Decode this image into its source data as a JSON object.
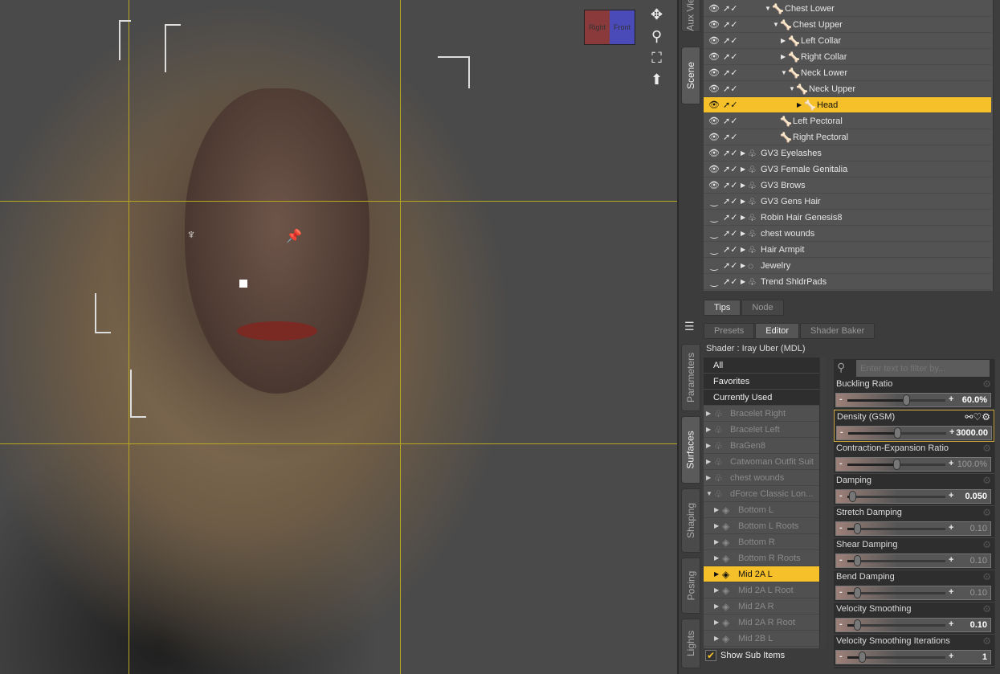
{
  "viewport": {
    "cube_faces": [
      "Right",
      "Front"
    ],
    "tools": [
      "pan-icon",
      "zoom-icon",
      "frame-icon",
      "orbit-icon"
    ]
  },
  "side_tabs_top": [
    "Aux Vie",
    "Scene"
  ],
  "side_tabs_bottom": [
    "Parameters",
    "Surfaces",
    "Shaping",
    "Posing",
    "Lights"
  ],
  "scene": {
    "rows": [
      {
        "label": "Chest Lower",
        "level": 4,
        "type": "bone",
        "expand": "open",
        "visible": true
      },
      {
        "label": "Chest Upper",
        "level": 5,
        "type": "bone",
        "expand": "open",
        "visible": true
      },
      {
        "label": "Left Collar",
        "level": 6,
        "type": "bone",
        "expand": "closed",
        "visible": true
      },
      {
        "label": "Right Collar",
        "level": 6,
        "type": "bone",
        "expand": "closed",
        "visible": true
      },
      {
        "label": "Neck Lower",
        "level": 6,
        "type": "bone",
        "expand": "open",
        "visible": true
      },
      {
        "label": "Neck Upper",
        "level": 7,
        "type": "bone",
        "expand": "open",
        "visible": true
      },
      {
        "label": "Head",
        "level": 8,
        "type": "bone",
        "expand": "closed",
        "visible": true,
        "selected": true
      },
      {
        "label": "Left Pectoral",
        "level": 5,
        "type": "bone",
        "expand": "none",
        "visible": true
      },
      {
        "label": "Right Pectoral",
        "level": 5,
        "type": "bone",
        "expand": "none",
        "visible": true
      },
      {
        "label": "GV3 Eyelashes",
        "level": 1,
        "type": "figure",
        "expand": "closed",
        "visible": true
      },
      {
        "label": "GV3 Female Genitalia",
        "level": 1,
        "type": "figure",
        "expand": "closed",
        "visible": true
      },
      {
        "label": "GV3 Brows",
        "level": 1,
        "type": "figure",
        "expand": "closed",
        "visible": true
      },
      {
        "label": "GV3 Gens Hair",
        "level": 1,
        "type": "figure",
        "expand": "closed",
        "visible": false
      },
      {
        "label": "Robin Hair Genesis8",
        "level": 1,
        "type": "figure",
        "expand": "closed",
        "visible": false
      },
      {
        "label": "chest wounds",
        "level": 1,
        "type": "figure",
        "expand": "closed",
        "visible": false
      },
      {
        "label": "Hair Armpit",
        "level": 1,
        "type": "figure",
        "expand": "closed",
        "visible": false
      },
      {
        "label": "Jewelry",
        "level": 1,
        "type": "group",
        "expand": "closed",
        "visible": false
      },
      {
        "label": "Trend ShldrPads",
        "level": 1,
        "type": "figure",
        "expand": "closed",
        "visible": false
      }
    ]
  },
  "lower_tabs": [
    "Tips",
    "Node"
  ],
  "editor_tabs": [
    "Presets",
    "Editor",
    "Shader Baker"
  ],
  "shader_label": "Shader : Iray Uber (MDL)",
  "surface_list": {
    "top_items": [
      "All",
      "Favorites",
      "Currently Used"
    ],
    "items": [
      {
        "label": "Bracelet  Right",
        "level": 0,
        "type": "figure",
        "expand": "closed"
      },
      {
        "label": "Bracelet Left",
        "level": 0,
        "type": "figure",
        "expand": "closed"
      },
      {
        "label": "BraGen8",
        "level": 0,
        "type": "figure",
        "expand": "closed"
      },
      {
        "label": "Catwoman Outfit Suit",
        "level": 0,
        "type": "figure",
        "expand": "closed"
      },
      {
        "label": "chest wounds",
        "level": 0,
        "type": "figure",
        "expand": "closed"
      },
      {
        "label": "dForce Classic Lon...",
        "level": 0,
        "type": "figure",
        "expand": "open"
      },
      {
        "label": "Bottom L",
        "level": 1,
        "type": "surface",
        "expand": "closed"
      },
      {
        "label": "Bottom L Roots",
        "level": 1,
        "type": "surface",
        "expand": "closed"
      },
      {
        "label": "Bottom R",
        "level": 1,
        "type": "surface",
        "expand": "closed"
      },
      {
        "label": "Bottom R Roots",
        "level": 1,
        "type": "surface",
        "expand": "closed"
      },
      {
        "label": "Mid 2A L",
        "level": 1,
        "type": "surface",
        "expand": "closed",
        "selected": true
      },
      {
        "label": "Mid 2A L Root",
        "level": 1,
        "type": "surface",
        "expand": "closed"
      },
      {
        "label": "Mid 2A R",
        "level": 1,
        "type": "surface",
        "expand": "closed"
      },
      {
        "label": "Mid 2A R Root",
        "level": 1,
        "type": "surface",
        "expand": "closed"
      },
      {
        "label": "Mid 2B L",
        "level": 1,
        "type": "surface",
        "expand": "closed"
      }
    ],
    "show_sub_items": {
      "label": "Show Sub Items",
      "checked": true
    }
  },
  "filter": {
    "placeholder": "Enter text to filter by..."
  },
  "params": [
    {
      "name": "Buckling Ratio",
      "value": "60.0%",
      "fraction": 0.6,
      "bright": true
    },
    {
      "name": "Density (GSM)",
      "value": "3000.00",
      "fraction": 0.5,
      "bright": true,
      "highlighted": true
    },
    {
      "name": "Contraction-Expansion Ratio",
      "value": "100.0%",
      "fraction": 0.5,
      "bright": false
    },
    {
      "name": "Damping",
      "value": "0.050",
      "fraction": 0.05,
      "bright": true
    },
    {
      "name": "Stretch Damping",
      "value": "0.10",
      "fraction": 0.1,
      "bright": false
    },
    {
      "name": "Shear Damping",
      "value": "0.10",
      "fraction": 0.1,
      "bright": false
    },
    {
      "name": "Bend Damping",
      "value": "0.10",
      "fraction": 0.1,
      "bright": false
    },
    {
      "name": "Velocity Smoothing",
      "value": "0.10",
      "fraction": 0.1,
      "bright": true
    },
    {
      "name": "Velocity Smoothing Iterations",
      "value": "1",
      "fraction": 0.15,
      "bright": true
    }
  ]
}
